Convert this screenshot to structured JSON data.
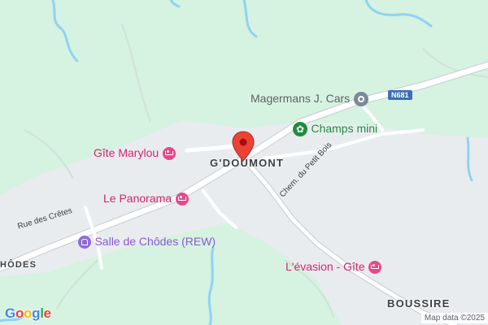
{
  "map": {
    "colors": {
      "land": "#d6f2e0",
      "built": "#e9ecef",
      "road": "#ffffff",
      "stream": "#8fd3f5",
      "pin": "#ea4335"
    },
    "pois": [
      {
        "id": "gite-marylou",
        "label": "Gîte Marylou",
        "icon": "hotel-icon"
      },
      {
        "id": "le-panorama",
        "label": "Le Panorama",
        "icon": "hotel-icon"
      },
      {
        "id": "salle-de-chodes",
        "label": "Salle de Chôdes (REW)",
        "icon": "event-venue-icon"
      },
      {
        "id": "levasion-gite",
        "label": "L'évasion - Gîte",
        "icon": "hotel-icon"
      },
      {
        "id": "magermans",
        "label": "Magermans J. Cars",
        "icon": "travel-icon"
      },
      {
        "id": "champs-mini",
        "label": "Champs mini",
        "icon": "park-icon"
      }
    ],
    "places": {
      "gdoumont": "G'DOUMONT",
      "boussire": "BOUSSIRE",
      "chodes": "HÔDES"
    },
    "roads": {
      "crete": "Rue des Crêtes",
      "petit_bois": "Chem. du Petit Bois",
      "route_shield": "N681"
    },
    "pin": {
      "icon": "location-pin-icon"
    },
    "footer": {
      "logo_letters": [
        "G",
        "o",
        "o",
        "g",
        "l",
        "e"
      ],
      "logo_colors": [
        "#4285f4",
        "#ea4335",
        "#fbbc05",
        "#4285f4",
        "#34a853",
        "#ea4335"
      ],
      "attribution": "Map data ©2025"
    }
  }
}
